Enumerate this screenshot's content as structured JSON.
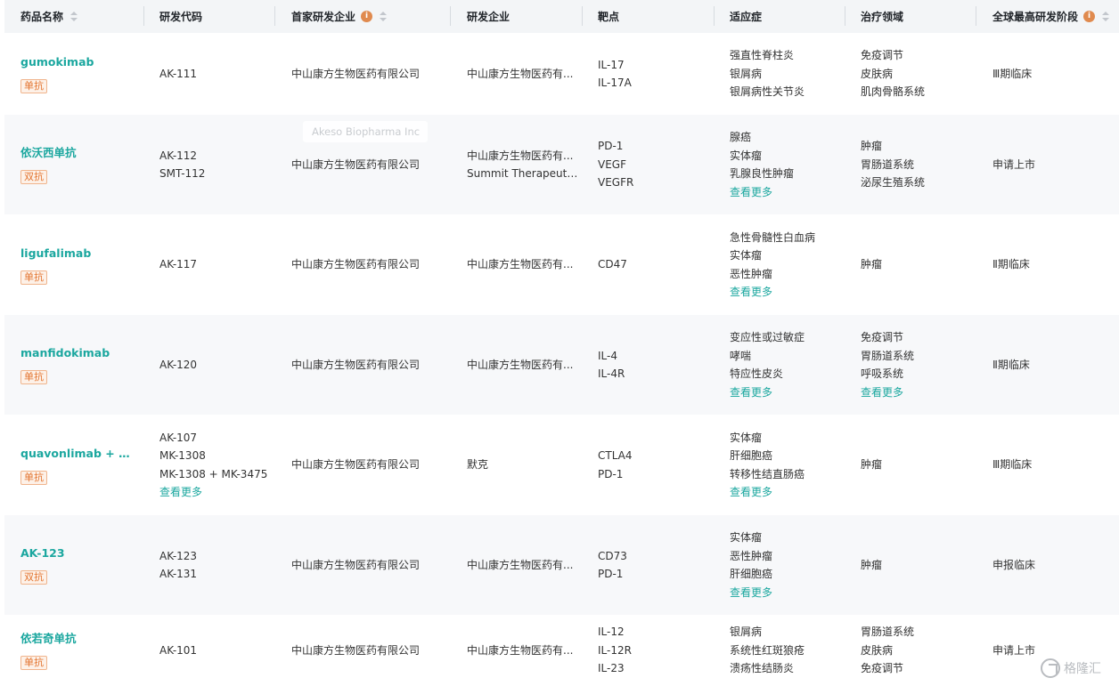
{
  "headers": [
    {
      "label": "药品名称",
      "sortable": true,
      "info": false
    },
    {
      "label": "研发代码",
      "sortable": false,
      "info": false
    },
    {
      "label": "首家研发企业",
      "sortable": true,
      "info": true
    },
    {
      "label": "研发企业",
      "sortable": false,
      "info": false
    },
    {
      "label": "靶点",
      "sortable": false,
      "info": false
    },
    {
      "label": "适应症",
      "sortable": false,
      "info": false
    },
    {
      "label": "治疗领域",
      "sortable": false,
      "info": false
    },
    {
      "label": "全球最高研发阶段",
      "sortable": true,
      "info": true
    }
  ],
  "more_label": "查看更多",
  "tooltip": "Akeso Biopharma Inc",
  "logo_text": "格隆汇",
  "rows": [
    {
      "name": "gumokimab",
      "badge": "单抗",
      "codes": [
        "AK-111"
      ],
      "codes_more": false,
      "first_company": "中山康方生物医药有限公司",
      "companies": [
        "中山康方生物医药有..."
      ],
      "targets": [
        "IL-17",
        "IL-17A"
      ],
      "indications": [
        "强直性脊柱炎",
        "银屑病",
        "银屑病性关节炎"
      ],
      "indications_more": false,
      "areas": [
        "免疫调节",
        "皮肤病",
        "肌肉骨骼系统"
      ],
      "areas_more": false,
      "stage": "Ⅲ期临床"
    },
    {
      "name": "依沃西单抗",
      "badge": "双抗",
      "codes": [
        "AK-112",
        "SMT-112"
      ],
      "codes_more": false,
      "first_company": "中山康方生物医药有限公司",
      "companies": [
        "中山康方生物医药有...",
        "Summit Therapeuti..."
      ],
      "targets": [
        "PD-1",
        "VEGF",
        "VEGFR"
      ],
      "indications": [
        "腺癌",
        "实体瘤",
        "乳腺良性肿瘤"
      ],
      "indications_more": true,
      "areas": [
        "肿瘤",
        "胃肠道系统",
        "泌尿生殖系统"
      ],
      "areas_more": false,
      "stage": "申请上市"
    },
    {
      "name": "ligufalimab",
      "badge": "单抗",
      "codes": [
        "AK-117"
      ],
      "codes_more": false,
      "first_company": "中山康方生物医药有限公司",
      "companies": [
        "中山康方生物医药有..."
      ],
      "targets": [
        "CD47"
      ],
      "indications": [
        "急性骨髓性白血病",
        "实体瘤",
        "恶性肿瘤"
      ],
      "indications_more": true,
      "areas": [
        "肿瘤"
      ],
      "areas_more": false,
      "stage": "Ⅱ期临床"
    },
    {
      "name": "manfidokimab",
      "badge": "单抗",
      "codes": [
        "AK-120"
      ],
      "codes_more": false,
      "first_company": "中山康方生物医药有限公司",
      "companies": [
        "中山康方生物医药有..."
      ],
      "targets": [
        "IL-4",
        "IL-4R"
      ],
      "indications": [
        "变应性或过敏症",
        "哮喘",
        "特应性皮炎"
      ],
      "indications_more": true,
      "areas": [
        "免疫调节",
        "胃肠道系统",
        "呼吸系统"
      ],
      "areas_more": true,
      "stage": "Ⅱ期临床"
    },
    {
      "name": "quavonlimab + 帕...",
      "badge": "单抗",
      "codes": [
        "AK-107",
        "MK-1308",
        "MK-1308 + MK-3475"
      ],
      "codes_more": true,
      "first_company": "中山康方生物医药有限公司",
      "companies": [
        "默克"
      ],
      "targets": [
        "CTLA4",
        "PD-1"
      ],
      "indications": [
        "实体瘤",
        "肝细胞癌",
        "转移性结直肠癌"
      ],
      "indications_more": true,
      "areas": [
        "肿瘤"
      ],
      "areas_more": false,
      "stage": "Ⅲ期临床"
    },
    {
      "name": "AK-123",
      "badge": "双抗",
      "codes": [
        "AK-123",
        "AK-131"
      ],
      "codes_more": false,
      "first_company": "中山康方生物医药有限公司",
      "companies": [
        "中山康方生物医药有..."
      ],
      "targets": [
        "CD73",
        "PD-1"
      ],
      "indications": [
        "实体瘤",
        "恶性肿瘤",
        "肝细胞癌"
      ],
      "indications_more": true,
      "areas": [
        "肿瘤"
      ],
      "areas_more": false,
      "stage": "申报临床"
    },
    {
      "name": "依若奇单抗",
      "badge": "单抗",
      "codes": [
        "AK-101"
      ],
      "codes_more": false,
      "first_company": "中山康方生物医药有限公司",
      "companies": [
        "中山康方生物医药有..."
      ],
      "targets": [
        "IL-12",
        "IL-12R",
        "IL-23"
      ],
      "indications": [
        "银屑病",
        "系统性红斑狼疮",
        "溃疡性结肠炎"
      ],
      "indications_more": false,
      "areas": [
        "胃肠道系统",
        "皮肤病",
        "免疫调节"
      ],
      "areas_more": false,
      "stage": "申请上市"
    }
  ]
}
